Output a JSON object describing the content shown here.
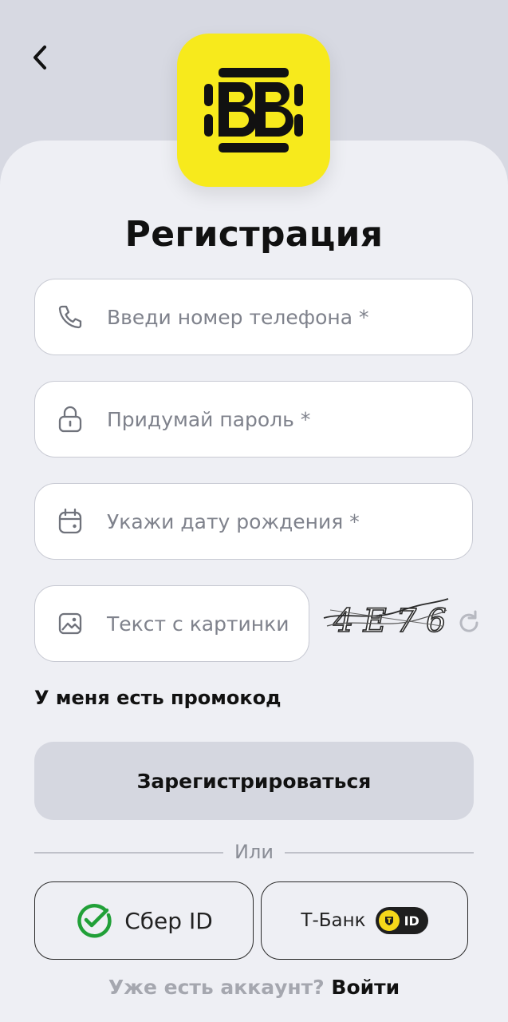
{
  "header": {
    "back_icon": "chevron-left-icon"
  },
  "logo": {
    "icon": "bb-logo",
    "color": "#f7ea1c"
  },
  "title": "Регистрация",
  "form": {
    "phone": {
      "icon": "phone-icon",
      "placeholder": "Введи номер телефона *",
      "value": ""
    },
    "password": {
      "icon": "lock-icon",
      "placeholder": "Придумай пароль *",
      "value": ""
    },
    "birthdate": {
      "icon": "calendar-icon",
      "placeholder": "Укажи дату рождения *",
      "value": ""
    },
    "captcha": {
      "icon": "image-icon",
      "placeholder": "Текст с картинки",
      "value": "",
      "captcha_text": "4E76",
      "refresh_icon": "refresh-icon"
    }
  },
  "promo_link": "У меня есть промокод",
  "register_button": "Зарегистрироваться",
  "divider_text": "Или",
  "alt_login": {
    "sber": {
      "icon": "sber-check-icon",
      "label": "Сбер ID",
      "color": "#21a038"
    },
    "tbank": {
      "label": "Т-Банк",
      "badge": "ID",
      "badge_color": "#f7d81a"
    }
  },
  "footer": {
    "question": "Уже есть аккаунт?",
    "login_link": "Войти"
  }
}
